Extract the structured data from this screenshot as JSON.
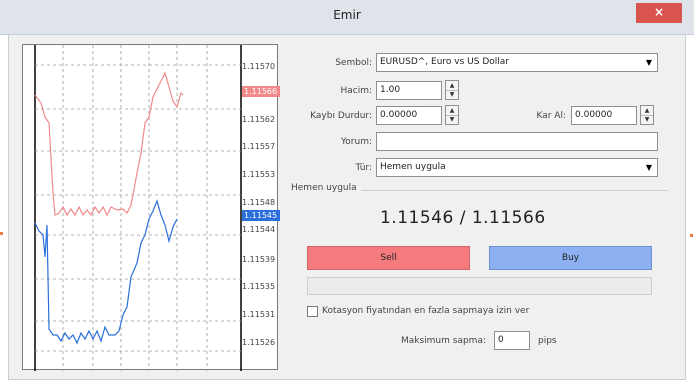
{
  "window": {
    "title": "Emir",
    "close_label": "×"
  },
  "chart": {
    "price_labels": [
      "1.11570",
      "1.11566",
      "1.11562",
      "1.11557",
      "1.11553",
      "1.11548",
      "1.11545",
      "1.11544",
      "1.11539",
      "1.11535",
      "1.11531",
      "1.11526"
    ],
    "ask_label": "1.11566",
    "bid_label": "1.11545",
    "colors": {
      "ask": "#f08a8a",
      "bid": "#2a6fdb"
    }
  },
  "form": {
    "symbol_label": "Sembol:",
    "symbol_value": "EURUSD^, Euro vs US Dollar",
    "volume_label": "Hacim:",
    "volume_value": "1.00",
    "stop_loss_label": "Kaybı Durdur:",
    "stop_loss_value": "0.00000",
    "take_profit_label": "Kar Al:",
    "take_profit_value": "0.00000",
    "comment_label": "Yorum:",
    "comment_value": "",
    "type_label": "Tür:",
    "type_value": "Hemen uygula"
  },
  "execution": {
    "group_title": "Hemen uygula",
    "price_display": "1.11546 / 1.11566",
    "sell_label": "Sell",
    "buy_label": "Buy",
    "deviation_checkbox_label": "Kotasyon fiyatından en fazla sapmaya izin ver",
    "max_deviation_label": "Maksimum sapma:",
    "max_deviation_value": "0",
    "pips_label": "pips"
  }
}
